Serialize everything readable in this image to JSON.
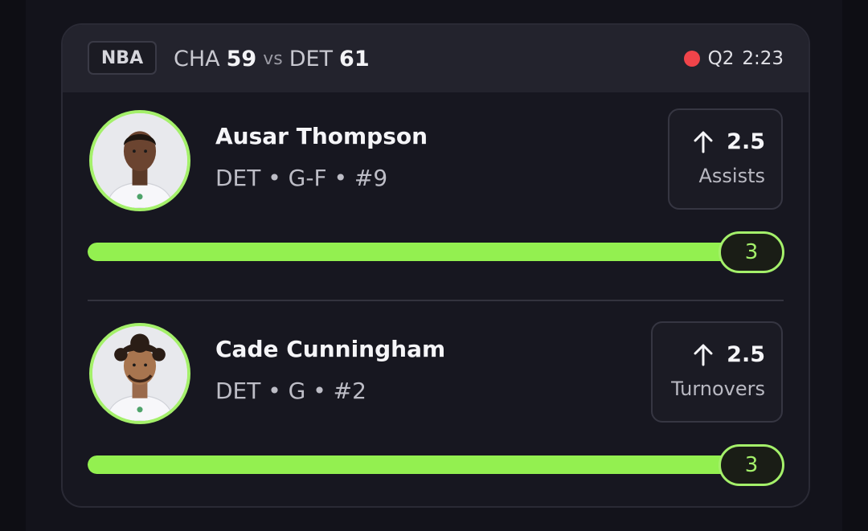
{
  "game": {
    "league": "NBA",
    "away_team": "CHA",
    "away_score": "59",
    "vs": "vs",
    "home_team": "DET",
    "home_score": "61",
    "period": "Q2",
    "clock": "2:23",
    "live_color": "#f0444a"
  },
  "props": [
    {
      "player_name": "Ausar Thompson",
      "player_meta": "DET • G-F • #9",
      "line": "2.5",
      "direction": "over",
      "direction_icon": "arrow-up-icon",
      "market": "Assists",
      "current": "3",
      "progress": 1.0
    },
    {
      "player_name": "Cade Cunningham",
      "player_meta": "DET • G • #2",
      "line": "2.5",
      "direction": "over",
      "direction_icon": "arrow-up-icon",
      "market": "Turnovers",
      "current": "3",
      "progress": 1.0
    }
  ],
  "colors": {
    "accent": "#93f050",
    "card_bg": "#171720",
    "header_bg": "#23232d"
  }
}
